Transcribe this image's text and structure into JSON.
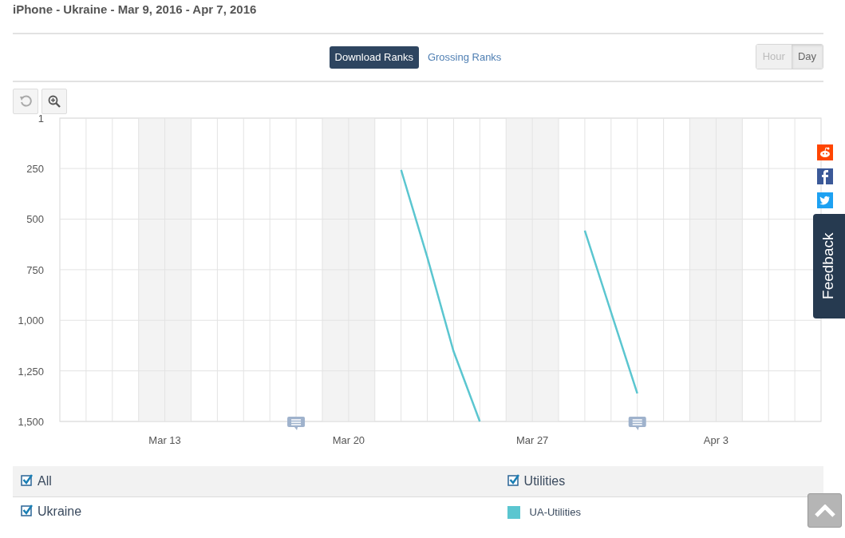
{
  "title": "iPhone - Ukraine - Mar 9, 2016 - Apr 7, 2016",
  "rank_tabs": [
    {
      "label": "Download Ranks",
      "selected": true
    },
    {
      "label": "Grossing Ranks",
      "selected": false
    }
  ],
  "granularity": [
    {
      "label": "Hour",
      "selected": false
    },
    {
      "label": "Day",
      "selected": true
    }
  ],
  "chart_data": {
    "type": "line",
    "categories": [
      null,
      null,
      null,
      null,
      "Mar 13",
      null,
      null,
      null,
      null,
      null,
      null,
      "Mar 20",
      null,
      null,
      null,
      null,
      null,
      null,
      "Mar 27",
      null,
      null,
      null,
      null,
      null,
      null,
      "Apr 3",
      null,
      null,
      null,
      null
    ],
    "ylim": [
      1500,
      1
    ],
    "yticks": [
      {
        "value": 1,
        "label": "1"
      },
      {
        "value": 250,
        "label": "250"
      },
      {
        "value": 500,
        "label": "500"
      },
      {
        "value": 750,
        "label": "750"
      },
      {
        "value": 1000,
        "label": "1,000"
      },
      {
        "value": 1250,
        "label": "1,250"
      },
      {
        "value": 1500,
        "label": "1,500"
      }
    ],
    "series": [
      {
        "name": "UA-Utilities",
        "color": "#5bc6d0",
        "values": [
          null,
          null,
          null,
          null,
          null,
          null,
          null,
          null,
          null,
          null,
          null,
          null,
          null,
          257,
          690,
          1153,
          1500,
          null,
          null,
          null,
          557,
          960,
          1361,
          null,
          null,
          null,
          null,
          null,
          null,
          null
        ]
      }
    ],
    "grid": true
  },
  "legend": {
    "header": [
      {
        "label": "All",
        "checked": true
      },
      {
        "label": "Utilities",
        "checked": true
      }
    ],
    "rows": [
      {
        "label": "Ukraine",
        "checked": true
      }
    ]
  },
  "feedback": "Feedback"
}
